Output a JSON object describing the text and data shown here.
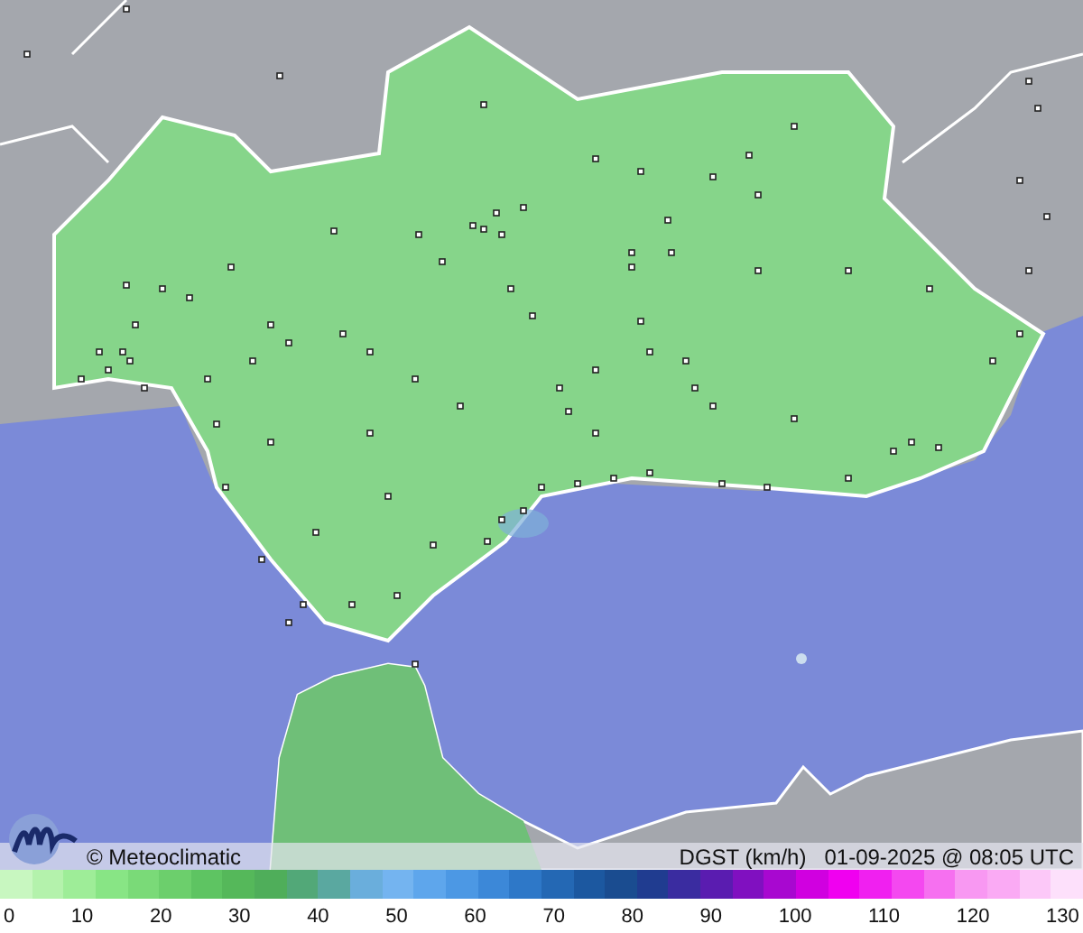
{
  "map": {
    "copyright": "© Meteoclimatic",
    "variable": "DGST (km/h)",
    "timestamp": "01-09-2025 @ 08:05 UTC"
  },
  "scale": {
    "labels": [
      "0",
      "10",
      "20",
      "30",
      "40",
      "50",
      "60",
      "70",
      "80",
      "90",
      "100",
      "110",
      "120",
      "130"
    ]
  }
}
